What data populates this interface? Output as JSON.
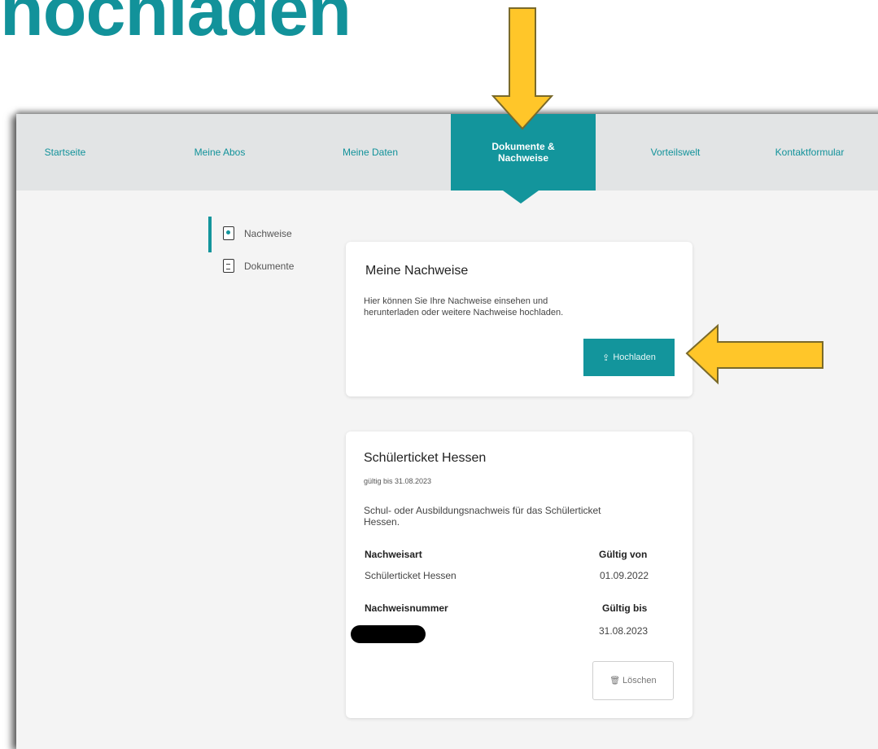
{
  "slide_title": "hochladen",
  "nav": {
    "items": [
      {
        "label": "Startseite"
      },
      {
        "label": "Meine Abos"
      },
      {
        "label": "Meine Daten"
      },
      {
        "label": "Dokumente &\nNachweise",
        "active": true
      },
      {
        "label": "Vorteilswelt"
      },
      {
        "label": "Kontaktformular"
      }
    ]
  },
  "sidebar": {
    "items": [
      {
        "label": "Nachweise",
        "icon": "document-filled-icon",
        "active": true
      },
      {
        "label": "Dokumente",
        "icon": "document-lines-icon"
      }
    ]
  },
  "nachweise_card": {
    "title": "Meine Nachweise",
    "text_line1": "Hier können Sie Ihre Nachweise einsehen und",
    "text_line2": "herunterladen oder weitere Nachweise hochladen.",
    "upload_icon": "⇪",
    "upload_label": "Hochladen"
  },
  "ticket_card": {
    "title": "Schülerticket Hessen",
    "valid_until": "gültig bis 31.08.2023",
    "desc_line1": "Schul- oder Ausbildungsnachweis für das Schülerticket",
    "desc_line2": "Hessen.",
    "col1_header": "Nachweisart",
    "col1_value": "Schülerticket Hessen",
    "col2_header": "Gültig von",
    "col2_value": "01.09.2022",
    "col3_header": "Nachweisnummer",
    "col4_header": "Gültig bis",
    "col4_value": "31.08.2023",
    "delete_icon": "🗑",
    "delete_label": "Löschen"
  },
  "colors": {
    "brand": "#13959c",
    "arrow": "#ffc629"
  }
}
